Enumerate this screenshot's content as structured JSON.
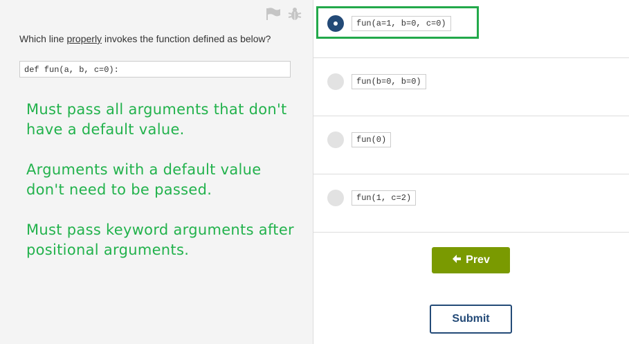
{
  "question": {
    "prefix": "Which line ",
    "underlined": "properly",
    "suffix": " invokes the function defined as below?",
    "code": "def fun(a, b, c=0):"
  },
  "notes": [
    "Must pass all arguments that don't have a default value.",
    "Arguments with a default value don't need to be passed.",
    "Must pass keyword arguments after positional arguments."
  ],
  "options": [
    {
      "code": "fun(a=1, b=0, c=0)",
      "selected": true
    },
    {
      "code": "fun(b=0, b=0)",
      "selected": false
    },
    {
      "code": "fun(0)",
      "selected": false
    },
    {
      "code": "fun(1, c=2)",
      "selected": false
    }
  ],
  "buttons": {
    "prev": "Prev",
    "submit": "Submit"
  },
  "icons": {
    "flag": "flag-icon",
    "bug": "bug-icon",
    "prev_arrow": "arrow-left-icon"
  },
  "colors": {
    "accent_green": "#22b24c",
    "prev_bg": "#7a9a01",
    "navy": "#234a77",
    "highlight": "#22a94a"
  }
}
